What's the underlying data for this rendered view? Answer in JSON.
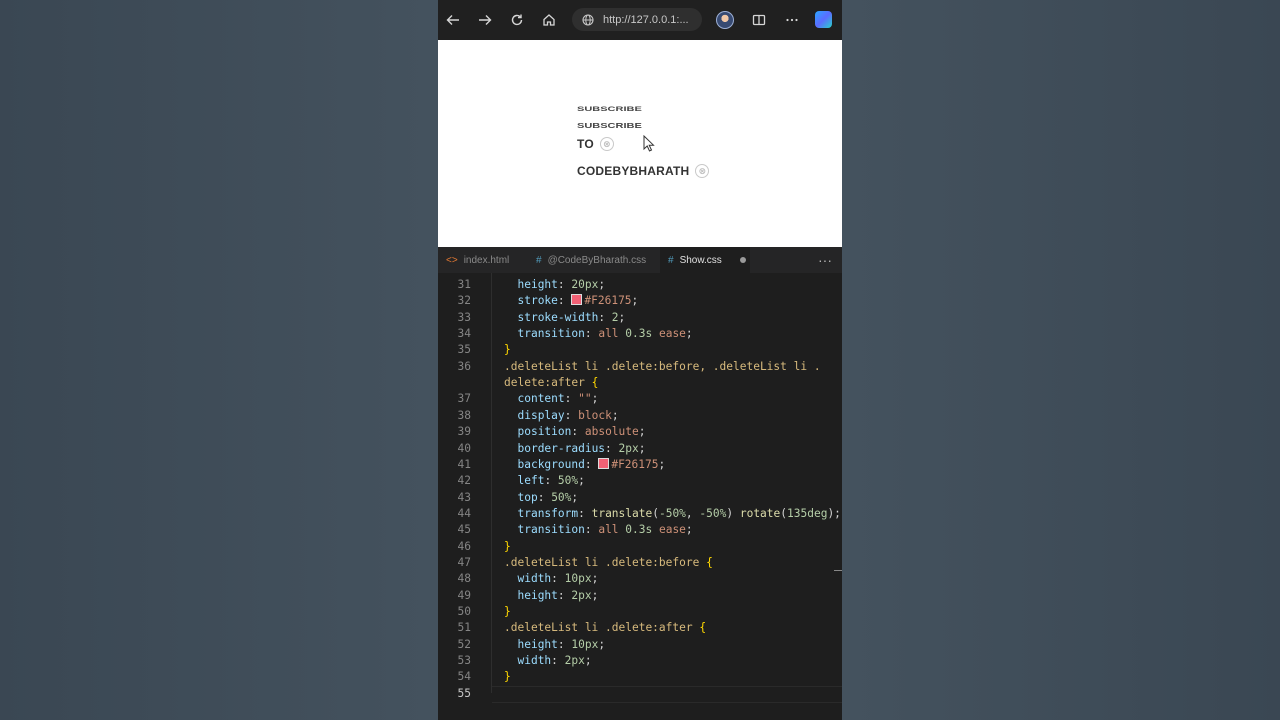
{
  "browser": {
    "url": "http://127.0.0.1:..."
  },
  "page": {
    "ghost_text_1": "SUBSCRIBE",
    "ghost_text_2": "SUBSCRIBE",
    "items": [
      {
        "label": "TO",
        "delete_glyph": "⊗"
      },
      {
        "label": "CODEBYBHARATH",
        "delete_glyph": "⊗"
      }
    ]
  },
  "editor": {
    "tabs": [
      {
        "glyph": "<>",
        "label": "index.html",
        "active": false,
        "modified": false,
        "glyph_color": "#e37933"
      },
      {
        "glyph": "#",
        "label": "@CodeByBharath.css",
        "active": false,
        "modified": true,
        "glyph_color": "#519aba"
      },
      {
        "glyph": "#",
        "label": "Show.css",
        "active": true,
        "modified": true,
        "glyph_color": "#519aba"
      }
    ],
    "more_label": "···",
    "swatch_color": "#F26175",
    "lines": [
      {
        "n": "31",
        "indent": "  ",
        "parts": [
          [
            "prop",
            "height"
          ],
          [
            "plain",
            ": "
          ],
          [
            "num",
            "20px"
          ],
          [
            "plain",
            ";"
          ]
        ]
      },
      {
        "n": "32",
        "indent": "  ",
        "parts": [
          [
            "prop",
            "stroke"
          ],
          [
            "plain",
            ": "
          ],
          [
            "swatch",
            ""
          ],
          [
            "val",
            "#F26175"
          ],
          [
            "plain",
            ";"
          ]
        ]
      },
      {
        "n": "33",
        "indent": "  ",
        "parts": [
          [
            "prop",
            "stroke-width"
          ],
          [
            "plain",
            ": "
          ],
          [
            "num",
            "2"
          ],
          [
            "plain",
            ";"
          ]
        ]
      },
      {
        "n": "34",
        "indent": "  ",
        "parts": [
          [
            "prop",
            "transition"
          ],
          [
            "plain",
            ": "
          ],
          [
            "val",
            "all "
          ],
          [
            "num",
            "0.3s"
          ],
          [
            "val",
            " ease"
          ],
          [
            "plain",
            ";"
          ]
        ]
      },
      {
        "n": "35",
        "indent": "",
        "parts": [
          [
            "brace",
            "}"
          ]
        ]
      },
      {
        "n": "36",
        "indent": "",
        "parts": [
          [
            "sel",
            ".deleteList li .delete:before, .deleteList li ."
          ]
        ]
      },
      {
        "n": "",
        "indent": "",
        "parts": [
          [
            "sel",
            "delete:after "
          ],
          [
            "brace",
            "{"
          ]
        ]
      },
      {
        "n": "37",
        "indent": "  ",
        "parts": [
          [
            "prop",
            "content"
          ],
          [
            "plain",
            ": "
          ],
          [
            "val",
            "\"\""
          ],
          [
            "plain",
            ";"
          ]
        ]
      },
      {
        "n": "38",
        "indent": "  ",
        "parts": [
          [
            "prop",
            "display"
          ],
          [
            "plain",
            ": "
          ],
          [
            "val",
            "block"
          ],
          [
            "plain",
            ";"
          ]
        ]
      },
      {
        "n": "39",
        "indent": "  ",
        "parts": [
          [
            "prop",
            "position"
          ],
          [
            "plain",
            ": "
          ],
          [
            "val",
            "absolute"
          ],
          [
            "plain",
            ";"
          ]
        ]
      },
      {
        "n": "40",
        "indent": "  ",
        "parts": [
          [
            "prop",
            "border-radius"
          ],
          [
            "plain",
            ": "
          ],
          [
            "num",
            "2px"
          ],
          [
            "plain",
            ";"
          ]
        ]
      },
      {
        "n": "41",
        "indent": "  ",
        "parts": [
          [
            "prop",
            "background"
          ],
          [
            "plain",
            ": "
          ],
          [
            "swatch",
            ""
          ],
          [
            "val",
            "#F26175"
          ],
          [
            "plain",
            ";"
          ]
        ]
      },
      {
        "n": "42",
        "indent": "  ",
        "parts": [
          [
            "prop",
            "left"
          ],
          [
            "plain",
            ": "
          ],
          [
            "num",
            "50%"
          ],
          [
            "plain",
            ";"
          ]
        ]
      },
      {
        "n": "43",
        "indent": "  ",
        "parts": [
          [
            "prop",
            "top"
          ],
          [
            "plain",
            ": "
          ],
          [
            "num",
            "50%"
          ],
          [
            "plain",
            ";"
          ]
        ]
      },
      {
        "n": "44",
        "indent": "  ",
        "parts": [
          [
            "prop",
            "transform"
          ],
          [
            "plain",
            ": "
          ],
          [
            "fn",
            "translate"
          ],
          [
            "plain",
            "("
          ],
          [
            "num",
            "-50%"
          ],
          [
            "plain",
            ", "
          ],
          [
            "num",
            "-50%"
          ],
          [
            "plain",
            ") "
          ],
          [
            "fn",
            "rotate"
          ],
          [
            "plain",
            "("
          ],
          [
            "num",
            "135deg"
          ],
          [
            "plain",
            ");"
          ]
        ]
      },
      {
        "n": "45",
        "indent": "  ",
        "parts": [
          [
            "prop",
            "transition"
          ],
          [
            "plain",
            ": "
          ],
          [
            "val",
            "all "
          ],
          [
            "num",
            "0.3s"
          ],
          [
            "val",
            " ease"
          ],
          [
            "plain",
            ";"
          ]
        ]
      },
      {
        "n": "46",
        "indent": "",
        "parts": [
          [
            "brace",
            "}"
          ]
        ]
      },
      {
        "n": "47",
        "indent": "",
        "parts": [
          [
            "sel",
            ".deleteList li .delete:before "
          ],
          [
            "brace",
            "{"
          ]
        ]
      },
      {
        "n": "48",
        "indent": "  ",
        "parts": [
          [
            "prop",
            "width"
          ],
          [
            "plain",
            ": "
          ],
          [
            "num",
            "10px"
          ],
          [
            "plain",
            ";"
          ]
        ]
      },
      {
        "n": "49",
        "indent": "  ",
        "parts": [
          [
            "prop",
            "height"
          ],
          [
            "plain",
            ": "
          ],
          [
            "num",
            "2px"
          ],
          [
            "plain",
            ";"
          ]
        ]
      },
      {
        "n": "50",
        "indent": "",
        "parts": [
          [
            "brace",
            "}"
          ]
        ]
      },
      {
        "n": "51",
        "indent": "",
        "parts": [
          [
            "sel",
            ".deleteList li .delete:after "
          ],
          [
            "brace",
            "{"
          ]
        ]
      },
      {
        "n": "52",
        "indent": "  ",
        "parts": [
          [
            "prop",
            "height"
          ],
          [
            "plain",
            ": "
          ],
          [
            "num",
            "10px"
          ],
          [
            "plain",
            ";"
          ]
        ]
      },
      {
        "n": "53",
        "indent": "  ",
        "parts": [
          [
            "prop",
            "width"
          ],
          [
            "plain",
            ": "
          ],
          [
            "num",
            "2px"
          ],
          [
            "plain",
            ";"
          ]
        ]
      },
      {
        "n": "54",
        "indent": "",
        "parts": [
          [
            "brace",
            "}"
          ]
        ]
      },
      {
        "n": "55",
        "indent": "",
        "parts": []
      }
    ],
    "current_line": "55"
  }
}
